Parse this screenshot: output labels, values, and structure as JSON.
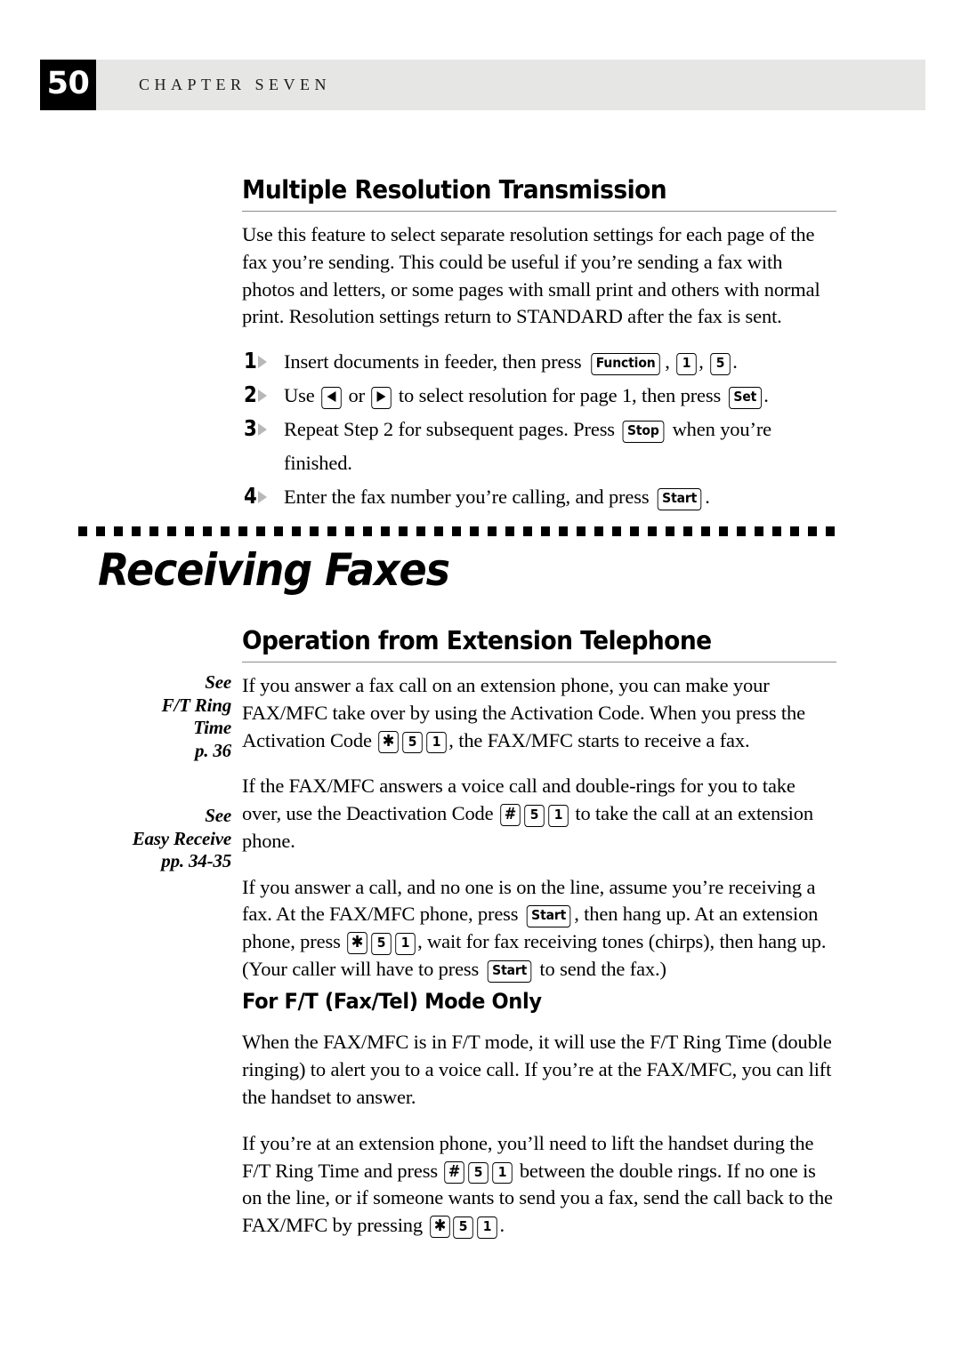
{
  "header": {
    "folio": "50",
    "chapter_label": "CHAPTER SEVEN",
    "strip_color": "#e6e7e5",
    "folio_bg": "#000000"
  },
  "section_one": {
    "title": "Multiple Resolution Transmission",
    "intro": "Use this feature to select separate resolution settings for each page of the fax you’re sending.  This could be useful if you’re sending a fax with photos and letters, or some pages with small print and others with normal print.  Resolution settings return to STANDARD after the fax is sent.",
    "steps": [
      {
        "number": "1",
        "parts": [
          {
            "t": "text",
            "v": "Insert documents in feeder, then press "
          },
          {
            "t": "key",
            "v": "Function"
          },
          {
            "t": "text",
            "v": ", "
          },
          {
            "t": "key",
            "v": "1"
          },
          {
            "t": "text",
            "v": ", "
          },
          {
            "t": "key",
            "v": "5"
          },
          {
            "t": "text",
            "v": "."
          }
        ]
      },
      {
        "number": "2",
        "parts": [
          {
            "t": "text",
            "v": "Use "
          },
          {
            "t": "key",
            "v": "arrow-left"
          },
          {
            "t": "text",
            "v": " or "
          },
          {
            "t": "key",
            "v": "arrow-right"
          },
          {
            "t": "text",
            "v": " to select resolution for page 1, then press "
          },
          {
            "t": "key",
            "v": "Set"
          },
          {
            "t": "text",
            "v": "."
          }
        ]
      },
      {
        "number": "3",
        "parts": [
          {
            "t": "text",
            "v": "Repeat Step 2 for subsequent pages.  Press "
          },
          {
            "t": "key",
            "v": "Stop"
          },
          {
            "t": "text",
            "v": " when you’re finished."
          }
        ]
      },
      {
        "number": "4",
        "parts": [
          {
            "t": "text",
            "v": "Enter the fax number you’re calling, and press "
          },
          {
            "t": "key",
            "v": "Start"
          },
          {
            "t": "text",
            "v": "."
          }
        ]
      }
    ]
  },
  "part_title": "Receiving Faxes",
  "section_two": {
    "title": "Operation from Extension Telephone",
    "margin_notes": [
      {
        "lines": [
          "See",
          "F/T Ring",
          "Time",
          "p. 36"
        ]
      },
      {
        "lines": [
          "See",
          "Easy Receive",
          "pp. 34-35"
        ]
      }
    ],
    "paragraphs": [
      {
        "parts": [
          {
            "t": "text",
            "v": "If you answer a fax call on an extension phone, you can make your FAX/MFC take over by using the Activation Code. When you press the Activation Code "
          },
          {
            "t": "key",
            "v": "star"
          },
          {
            "t": "key",
            "v": "5"
          },
          {
            "t": "key",
            "v": "1"
          },
          {
            "t": "text",
            "v": ", the FAX/MFC starts to receive a fax."
          }
        ]
      },
      {
        "parts": [
          {
            "t": "text",
            "v": "If the FAX/MFC answers a voice call and double-rings for you to take over, use the Deactivation Code "
          },
          {
            "t": "key",
            "v": "hash"
          },
          {
            "t": "key",
            "v": "5"
          },
          {
            "t": "key",
            "v": "1"
          },
          {
            "t": "text",
            "v": " to take the call at an extension phone."
          }
        ]
      },
      {
        "parts": [
          {
            "t": "text",
            "v": "If you answer a call, and no one is on the line, assume you’re receiving a fax. At the FAX/MFC phone, press "
          },
          {
            "t": "key",
            "v": "Start"
          },
          {
            "t": "text",
            "v": ", then hang up. At an extension phone, press "
          },
          {
            "t": "key",
            "v": "star"
          },
          {
            "t": "key",
            "v": "5"
          },
          {
            "t": "key",
            "v": "1"
          },
          {
            "t": "text",
            "v": ", wait for fax receiving tones (chirps), then hang up. (Your caller will have to press "
          },
          {
            "t": "key",
            "v": "Start"
          },
          {
            "t": "text",
            "v": " to send the fax.)"
          }
        ]
      }
    ]
  },
  "subsection": {
    "title": "For F/T (Fax/Tel) Mode Only",
    "paragraphs": [
      {
        "parts": [
          {
            "t": "text",
            "v": "When the FAX/MFC is in F/T mode, it will use the F/T Ring Time (double ringing) to alert you to a voice call. If you’re at the FAX/MFC, you can lift the handset to answer."
          }
        ]
      },
      {
        "parts": [
          {
            "t": "text",
            "v": "If you’re at an extension phone, you’ll need to lift the handset during the F/T Ring Time and press "
          },
          {
            "t": "key",
            "v": "hash"
          },
          {
            "t": "key",
            "v": "5"
          },
          {
            "t": "key",
            "v": "1"
          },
          {
            "t": "text",
            "v": " between the double rings. If no one is on the line, or if someone wants to send you a fax, send the call back to the FAX/MFC by pressing "
          },
          {
            "t": "key",
            "v": "star"
          },
          {
            "t": "key",
            "v": "5"
          },
          {
            "t": "key",
            "v": "1"
          },
          {
            "t": "text",
            "v": "."
          }
        ]
      }
    ]
  },
  "keycaps": {
    "star": "✱",
    "hash": "#",
    "arrow-left": "◀",
    "arrow-right": "▶"
  }
}
